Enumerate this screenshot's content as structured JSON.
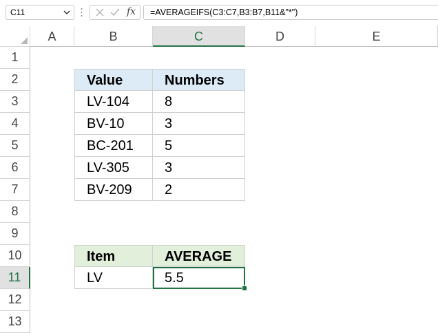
{
  "formula_bar": {
    "name_box": "C11",
    "cancel_icon": "cancel-icon",
    "enter_icon": "enter-icon",
    "fx_label": "fx",
    "formula": "=AVERAGEIFS(C3:C7,B3:B7,B11&\"*\")"
  },
  "columns": [
    "A",
    "B",
    "C",
    "D",
    "E"
  ],
  "rows": [
    "1",
    "2",
    "3",
    "4",
    "5",
    "6",
    "7",
    "8",
    "9",
    "10",
    "11",
    "12",
    "13"
  ],
  "selected": {
    "column": "C",
    "row": "11"
  },
  "table1": {
    "headers": [
      "Value",
      "Numbers"
    ],
    "rows": [
      [
        "LV-104",
        "8"
      ],
      [
        "BV-10",
        "3"
      ],
      [
        "BC-201",
        "5"
      ],
      [
        "LV-305",
        "3"
      ],
      [
        "BV-209",
        "2"
      ]
    ]
  },
  "table2": {
    "headers": [
      "Item",
      "AVERAGE"
    ],
    "rows": [
      [
        "LV",
        "5.5"
      ]
    ]
  },
  "colors": {
    "accent": "#217346",
    "table1_header": "#ddebf7",
    "table2_header": "#e2efda"
  }
}
